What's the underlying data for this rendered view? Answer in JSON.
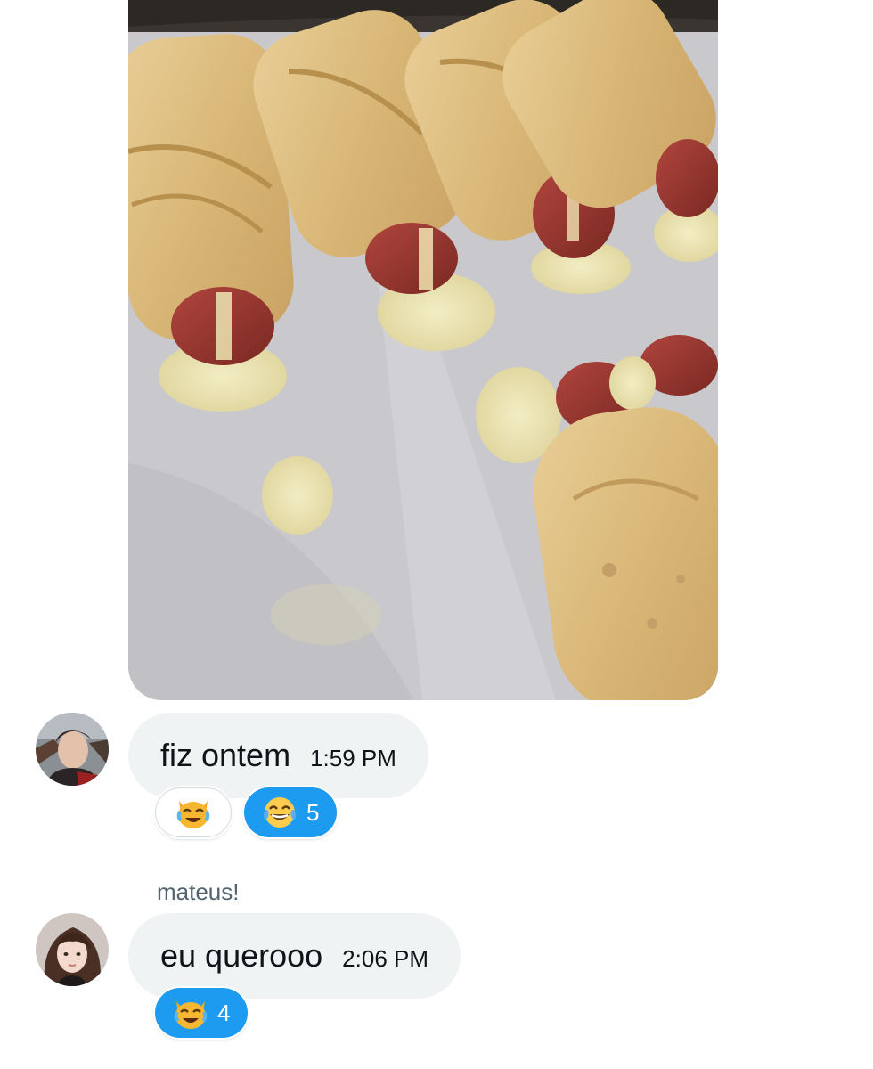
{
  "image_message": {
    "alt": "",
    "icon": "food-photo"
  },
  "messages": [
    {
      "sender_name": "",
      "text": "fiz ontem",
      "time": "1:59 PM",
      "avatar_icon": "user-avatar-male",
      "reactions": [
        {
          "emoji_icon": "cat-face-with-tears-of-joy-emoji",
          "count": "",
          "active": false
        },
        {
          "emoji_icon": "face-with-tears-of-joy-emoji",
          "count": "5",
          "active": true
        }
      ]
    },
    {
      "sender_name": "mateus!",
      "text": "eu querooo",
      "time": "2:06 PM",
      "avatar_icon": "user-avatar-female",
      "reactions": [
        {
          "emoji_icon": "cat-face-with-tears-of-joy-emoji",
          "count": "4",
          "active": true
        }
      ]
    }
  ],
  "colors": {
    "bubble_background": "#eff3f4",
    "reaction_active": "#1d9bf0",
    "secondary_text": "#536471"
  }
}
